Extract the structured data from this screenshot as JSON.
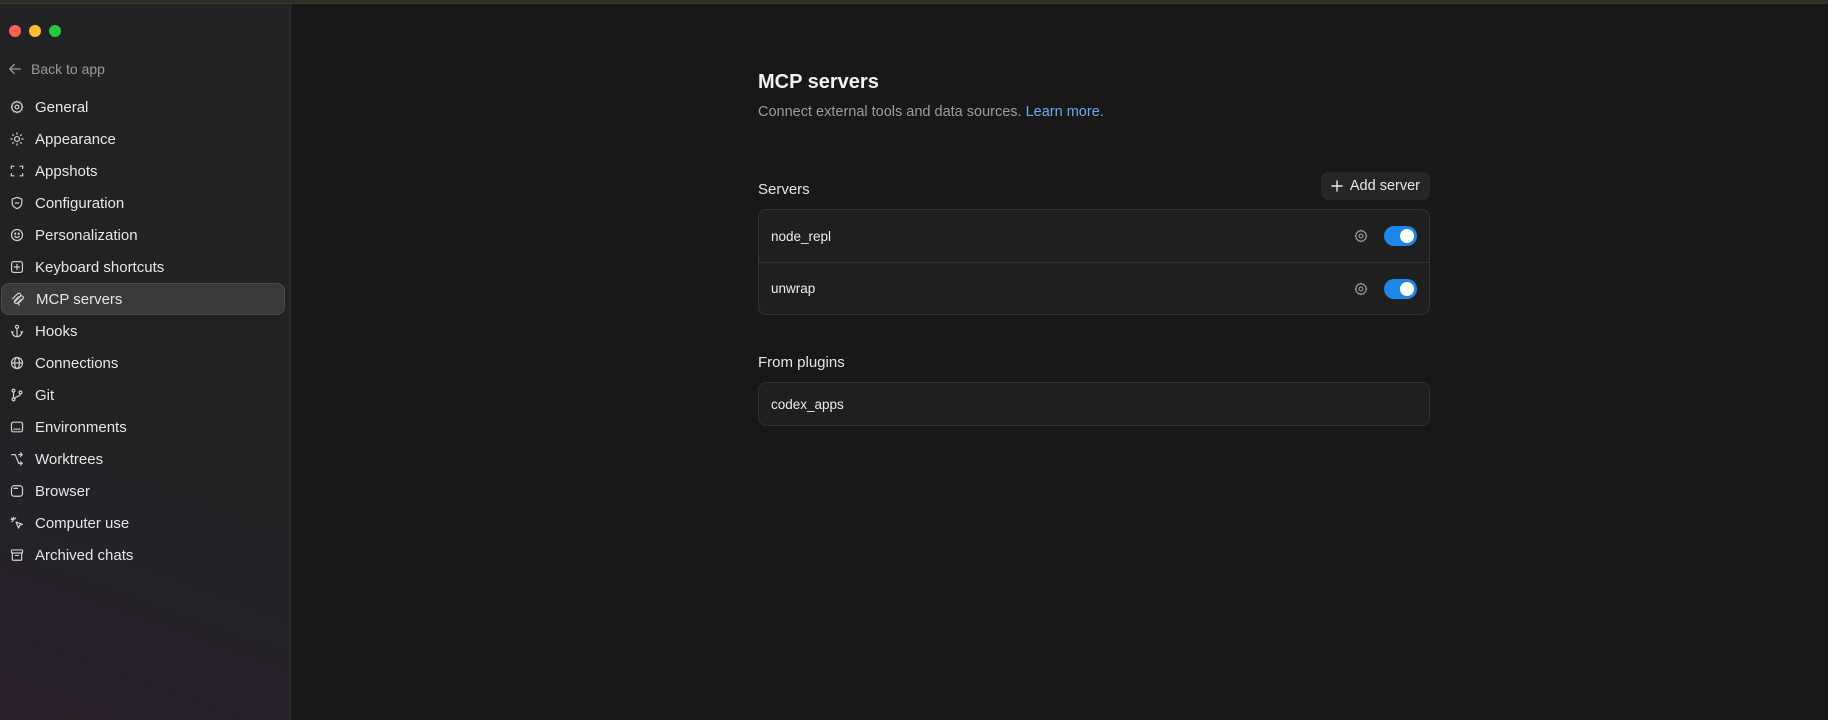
{
  "sidebar": {
    "back_label": "Back to app",
    "items": [
      {
        "label": "General",
        "icon": "gear-icon"
      },
      {
        "label": "Appearance",
        "icon": "sun-icon"
      },
      {
        "label": "Appshots",
        "icon": "screenshot-icon"
      },
      {
        "label": "Configuration",
        "icon": "shield-icon"
      },
      {
        "label": "Personalization",
        "icon": "smiley-icon"
      },
      {
        "label": "Keyboard shortcuts",
        "icon": "keyboard-icon"
      },
      {
        "label": "MCP servers",
        "icon": "mcp-icon",
        "active": true
      },
      {
        "label": "Hooks",
        "icon": "anchor-icon"
      },
      {
        "label": "Connections",
        "icon": "globe-icon"
      },
      {
        "label": "Git",
        "icon": "branch-icon"
      },
      {
        "label": "Environments",
        "icon": "monitor-icon"
      },
      {
        "label": "Worktrees",
        "icon": "worktree-icon"
      },
      {
        "label": "Browser",
        "icon": "browser-icon"
      },
      {
        "label": "Computer use",
        "icon": "cursor-click-icon"
      },
      {
        "label": "Archived chats",
        "icon": "archive-icon"
      }
    ]
  },
  "main": {
    "title": "MCP servers",
    "subtitle": "Connect external tools and data sources.",
    "learn_more": "Learn more.",
    "servers_label": "Servers",
    "add_server_label": "Add server",
    "servers": [
      {
        "name": "node_repl",
        "enabled": true
      },
      {
        "name": "unwrap",
        "enabled": true
      }
    ],
    "plugins_label": "From plugins",
    "plugins": [
      {
        "name": "codex_apps"
      }
    ]
  },
  "colors": {
    "accent": "#1c87e8",
    "link": "#6ea8f0",
    "background": "#181818",
    "sidebar": "#232325"
  }
}
